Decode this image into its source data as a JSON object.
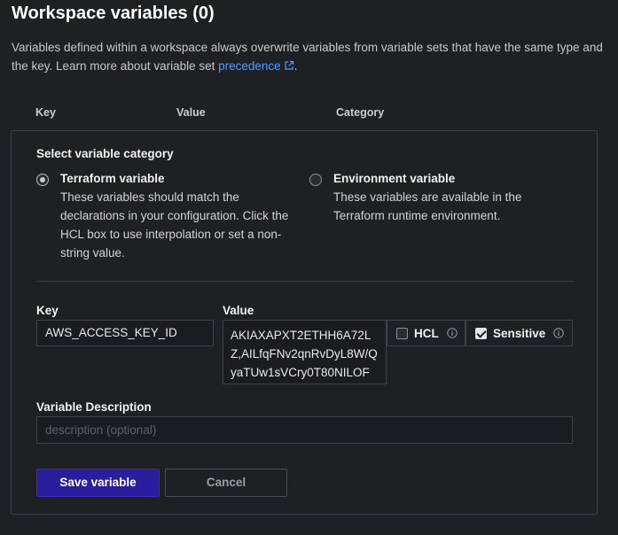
{
  "header": {
    "title": "Workspace variables (0)",
    "intro_text": "Variables defined within a workspace always overwrite variables from variable sets that have the same type and the key. Learn more about variable set ",
    "intro_link": "precedence",
    "intro_end": "."
  },
  "columns": {
    "key": "Key",
    "value": "Value",
    "category": "Category"
  },
  "form": {
    "category_label": "Select variable category",
    "options": [
      {
        "title": "Terraform variable",
        "description": "These variables should match the declarations in your configuration. Click the HCL box to use interpolation or set a non-string value.",
        "selected": true
      },
      {
        "title": "Environment variable",
        "description": "These variables are available in the Terraform runtime environment.",
        "selected": false
      }
    ],
    "key_label": "Key",
    "key_value": "AWS_ACCESS_KEY_ID",
    "value_label": "Value",
    "value_value": "AKIAXAPXT2ETHH6A72LZ,AILfqFNv2qnRvDyL8W/QyaTUw1sVCry0T80NILOF",
    "hcl_label": "HCL",
    "hcl_checked": false,
    "sensitive_label": "Sensitive",
    "sensitive_checked": true,
    "description_label": "Variable Description",
    "description_placeholder": "description (optional)",
    "save_button": "Save variable",
    "cancel_button": "Cancel"
  },
  "colors": {
    "background": "#1f2023",
    "link": "#4f9cff",
    "primary_button": "#2a1d9e"
  }
}
